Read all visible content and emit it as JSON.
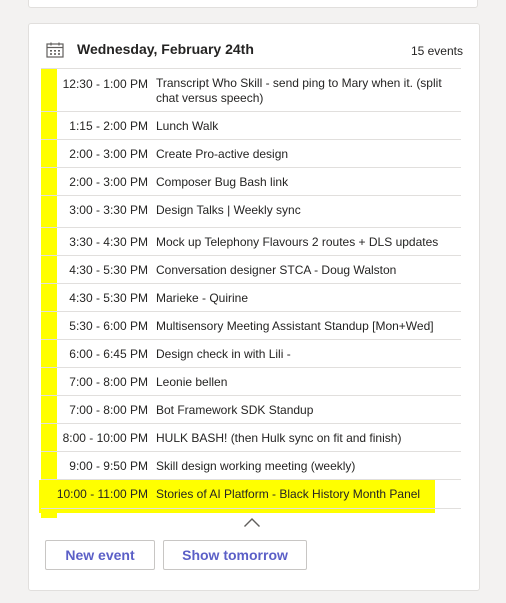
{
  "agenda": {
    "date_title": "Wednesday, February 24th",
    "event_count": "15 events",
    "highlight_color": "#ffff00",
    "events": [
      {
        "time": "12:30 - 1:00 PM",
        "title": "Transcript Who Skill - send ping to Mary when it. (split chat versus speech)"
      },
      {
        "time": "1:15 - 2:00 PM",
        "title": "Lunch Walk"
      },
      {
        "time": "2:00 - 3:00 PM",
        "title": "Create Pro-active design"
      },
      {
        "time": "2:00 - 3:00 PM",
        "title": "Composer Bug Bash link"
      },
      {
        "time": "3:00 - 3:30 PM",
        "title": "Design Talks | Weekly sync"
      },
      {
        "time": "3:30 - 4:30 PM",
        "title": "Mock up Telephony Flavours 2 routes + DLS updates"
      },
      {
        "time": "4:30 - 5:30 PM",
        "title": "Conversation designer STCA - Doug Walston"
      },
      {
        "time": "4:30 - 5:30 PM",
        "title": "Marieke - Quirine"
      },
      {
        "time": "5:30 - 6:00 PM",
        "title": "Multisensory Meeting Assistant Standup [Mon+Wed]"
      },
      {
        "time": "6:00 - 6:45 PM",
        "title": "Design check in with Lili -"
      },
      {
        "time": "7:00 - 8:00 PM",
        "title": "Leonie bellen"
      },
      {
        "time": "7:00 - 8:00 PM",
        "title": "Bot Framework SDK Standup"
      },
      {
        "time": "8:00 - 10:00 PM",
        "title": "HULK BASH! (then Hulk sync on fit and finish)"
      },
      {
        "time": "9:00 - 9:50 PM",
        "title": "Skill design working meeting (weekly)"
      },
      {
        "time": "10:00 - 11:00 PM",
        "title": "Stories of AI Platform - Black History Month Panel"
      }
    ],
    "collapse_icon": "chevron-up-icon",
    "buttons": {
      "new_event": "New event",
      "show_tomorrow": "Show tomorrow"
    }
  }
}
